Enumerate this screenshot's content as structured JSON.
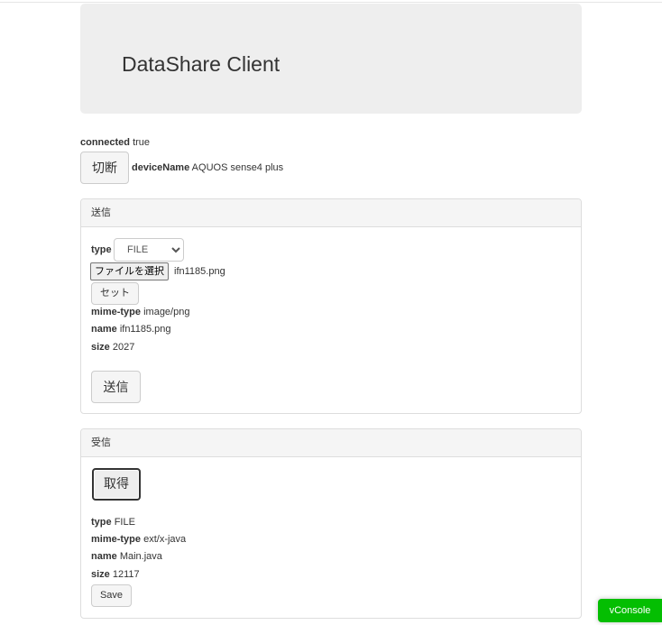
{
  "app": {
    "title": "DataShare Client"
  },
  "status": {
    "connected_label": "connected",
    "connected_value": "true",
    "disconnect_button": "切断",
    "device_label": "deviceName",
    "device_value": "AQUOS sense4 plus"
  },
  "send_panel": {
    "heading": "送信",
    "type_label": "type",
    "type_selected": "FILE",
    "file_button": "ファイルを選択",
    "file_name": "ifn1185.png",
    "set_button": "セット",
    "mime_label": "mime-type",
    "mime_value": "image/png",
    "name_label": "name",
    "name_value": "ifn1185.png",
    "size_label": "size",
    "size_value": "2027",
    "send_button": "送信"
  },
  "receive_panel": {
    "heading": "受信",
    "get_button": "取得",
    "type_label": "type",
    "type_value": "FILE",
    "mime_label": "mime-type",
    "mime_value": "ext/x-java",
    "name_label": "name",
    "name_value": "Main.java",
    "size_label": "size",
    "size_value": "12117",
    "save_button": "Save"
  },
  "vconsole": {
    "label": "vConsole",
    "color": "#04be02"
  }
}
